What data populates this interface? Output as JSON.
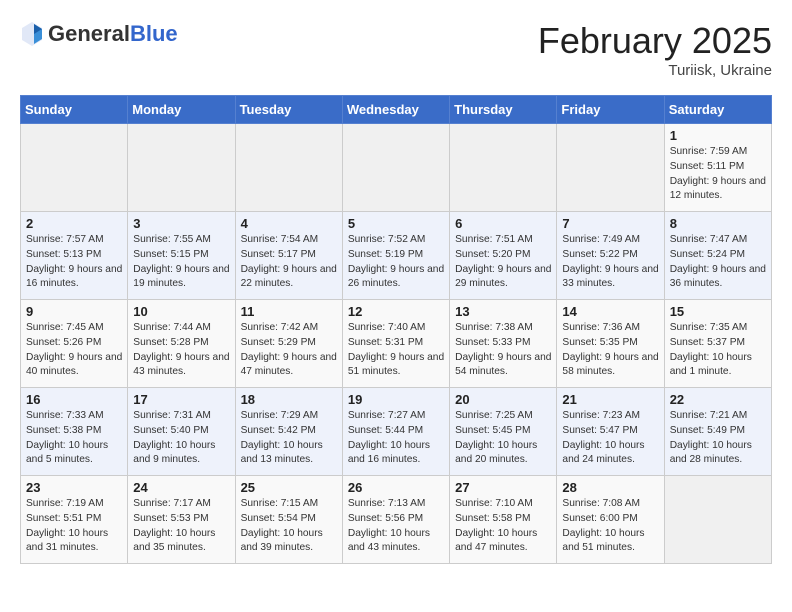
{
  "header": {
    "logo_general": "General",
    "logo_blue": "Blue",
    "calendar_title": "February 2025",
    "calendar_subtitle": "Turiisk, Ukraine"
  },
  "weekdays": [
    "Sunday",
    "Monday",
    "Tuesday",
    "Wednesday",
    "Thursday",
    "Friday",
    "Saturday"
  ],
  "weeks": [
    [
      {
        "day": "",
        "info": ""
      },
      {
        "day": "",
        "info": ""
      },
      {
        "day": "",
        "info": ""
      },
      {
        "day": "",
        "info": ""
      },
      {
        "day": "",
        "info": ""
      },
      {
        "day": "",
        "info": ""
      },
      {
        "day": "1",
        "info": "Sunrise: 7:59 AM\nSunset: 5:11 PM\nDaylight: 9 hours and 12 minutes."
      }
    ],
    [
      {
        "day": "2",
        "info": "Sunrise: 7:57 AM\nSunset: 5:13 PM\nDaylight: 9 hours and 16 minutes."
      },
      {
        "day": "3",
        "info": "Sunrise: 7:55 AM\nSunset: 5:15 PM\nDaylight: 9 hours and 19 minutes."
      },
      {
        "day": "4",
        "info": "Sunrise: 7:54 AM\nSunset: 5:17 PM\nDaylight: 9 hours and 22 minutes."
      },
      {
        "day": "5",
        "info": "Sunrise: 7:52 AM\nSunset: 5:19 PM\nDaylight: 9 hours and 26 minutes."
      },
      {
        "day": "6",
        "info": "Sunrise: 7:51 AM\nSunset: 5:20 PM\nDaylight: 9 hours and 29 minutes."
      },
      {
        "day": "7",
        "info": "Sunrise: 7:49 AM\nSunset: 5:22 PM\nDaylight: 9 hours and 33 minutes."
      },
      {
        "day": "8",
        "info": "Sunrise: 7:47 AM\nSunset: 5:24 PM\nDaylight: 9 hours and 36 minutes."
      }
    ],
    [
      {
        "day": "9",
        "info": "Sunrise: 7:45 AM\nSunset: 5:26 PM\nDaylight: 9 hours and 40 minutes."
      },
      {
        "day": "10",
        "info": "Sunrise: 7:44 AM\nSunset: 5:28 PM\nDaylight: 9 hours and 43 minutes."
      },
      {
        "day": "11",
        "info": "Sunrise: 7:42 AM\nSunset: 5:29 PM\nDaylight: 9 hours and 47 minutes."
      },
      {
        "day": "12",
        "info": "Sunrise: 7:40 AM\nSunset: 5:31 PM\nDaylight: 9 hours and 51 minutes."
      },
      {
        "day": "13",
        "info": "Sunrise: 7:38 AM\nSunset: 5:33 PM\nDaylight: 9 hours and 54 minutes."
      },
      {
        "day": "14",
        "info": "Sunrise: 7:36 AM\nSunset: 5:35 PM\nDaylight: 9 hours and 58 minutes."
      },
      {
        "day": "15",
        "info": "Sunrise: 7:35 AM\nSunset: 5:37 PM\nDaylight: 10 hours and 1 minute."
      }
    ],
    [
      {
        "day": "16",
        "info": "Sunrise: 7:33 AM\nSunset: 5:38 PM\nDaylight: 10 hours and 5 minutes."
      },
      {
        "day": "17",
        "info": "Sunrise: 7:31 AM\nSunset: 5:40 PM\nDaylight: 10 hours and 9 minutes."
      },
      {
        "day": "18",
        "info": "Sunrise: 7:29 AM\nSunset: 5:42 PM\nDaylight: 10 hours and 13 minutes."
      },
      {
        "day": "19",
        "info": "Sunrise: 7:27 AM\nSunset: 5:44 PM\nDaylight: 10 hours and 16 minutes."
      },
      {
        "day": "20",
        "info": "Sunrise: 7:25 AM\nSunset: 5:45 PM\nDaylight: 10 hours and 20 minutes."
      },
      {
        "day": "21",
        "info": "Sunrise: 7:23 AM\nSunset: 5:47 PM\nDaylight: 10 hours and 24 minutes."
      },
      {
        "day": "22",
        "info": "Sunrise: 7:21 AM\nSunset: 5:49 PM\nDaylight: 10 hours and 28 minutes."
      }
    ],
    [
      {
        "day": "23",
        "info": "Sunrise: 7:19 AM\nSunset: 5:51 PM\nDaylight: 10 hours and 31 minutes."
      },
      {
        "day": "24",
        "info": "Sunrise: 7:17 AM\nSunset: 5:53 PM\nDaylight: 10 hours and 35 minutes."
      },
      {
        "day": "25",
        "info": "Sunrise: 7:15 AM\nSunset: 5:54 PM\nDaylight: 10 hours and 39 minutes."
      },
      {
        "day": "26",
        "info": "Sunrise: 7:13 AM\nSunset: 5:56 PM\nDaylight: 10 hours and 43 minutes."
      },
      {
        "day": "27",
        "info": "Sunrise: 7:10 AM\nSunset: 5:58 PM\nDaylight: 10 hours and 47 minutes."
      },
      {
        "day": "28",
        "info": "Sunrise: 7:08 AM\nSunset: 6:00 PM\nDaylight: 10 hours and 51 minutes."
      },
      {
        "day": "",
        "info": ""
      }
    ]
  ]
}
